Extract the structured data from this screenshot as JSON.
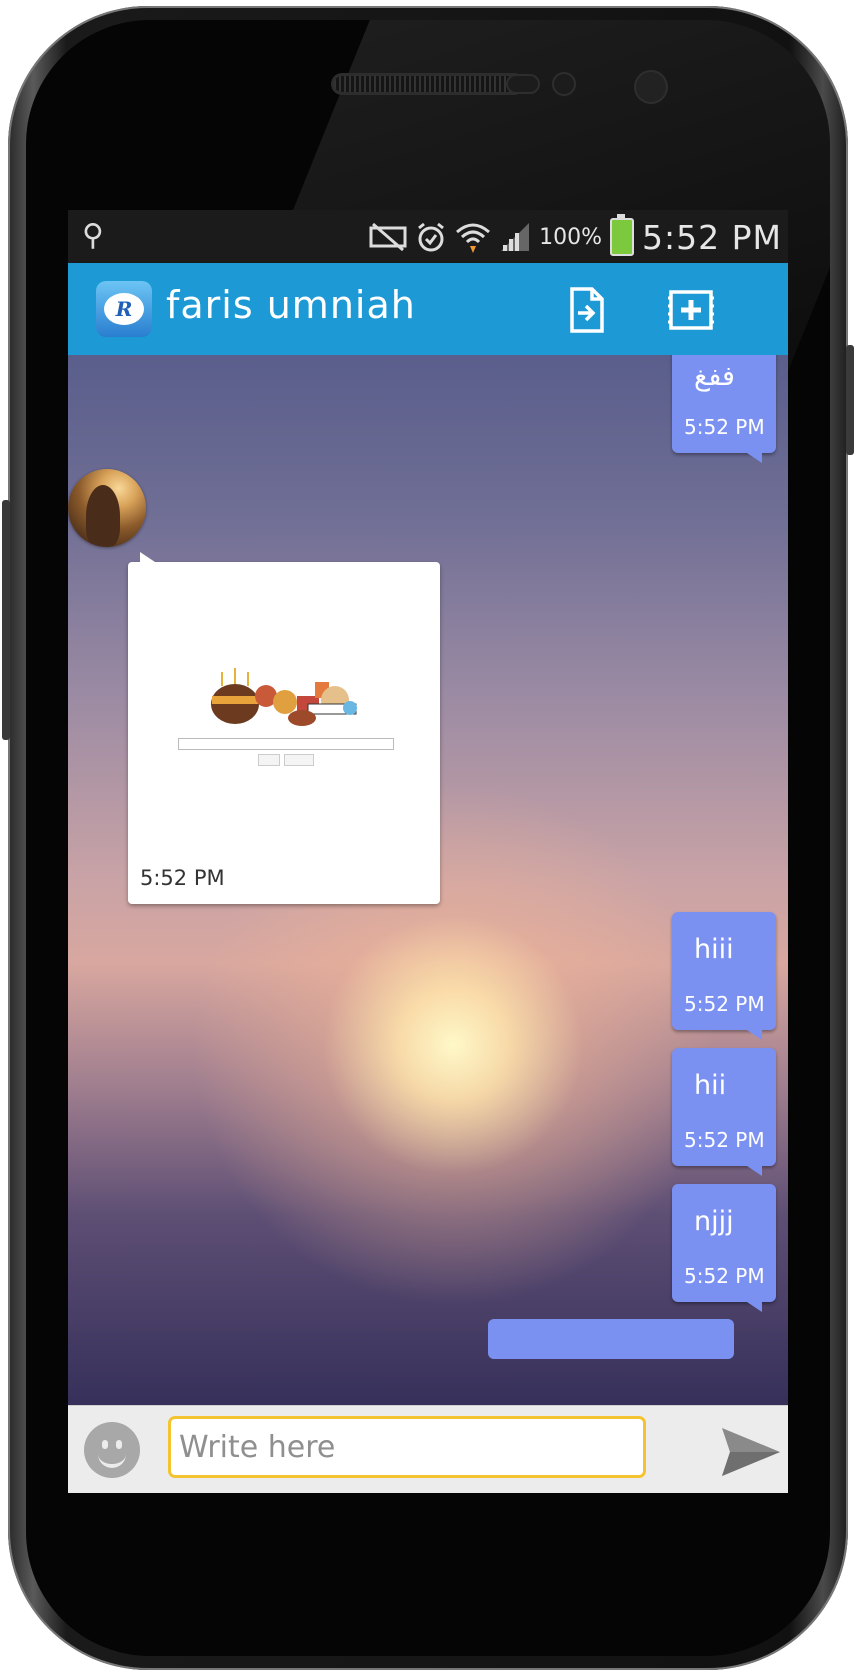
{
  "status_bar": {
    "usb_icon": "usb-icon",
    "icons": [
      "mute-icon",
      "alarm-icon",
      "wifi-icon",
      "signal-icon"
    ],
    "battery_percent": "100%",
    "time": "5:52 PM"
  },
  "app_bar": {
    "title": "faris umniah",
    "logo_letter": "R",
    "actions": [
      "export-icon",
      "add-media-icon"
    ]
  },
  "messages": {
    "m1": {
      "text": "ففغ",
      "time": "5:52 PM"
    },
    "image_message": {
      "time": "5:52 PM"
    },
    "m2": {
      "text": "hiii",
      "time": "5:52 PM"
    },
    "m3": {
      "text": "hii",
      "time": "5:52 PM"
    },
    "m4": {
      "text": "njjj",
      "time": "5:52 PM"
    }
  },
  "composer": {
    "placeholder": "Write here",
    "value": ""
  },
  "colors": {
    "app_bar": "#1d9ad6",
    "outgoing_bubble": "#7b91f2",
    "input_border": "#f4c430"
  }
}
